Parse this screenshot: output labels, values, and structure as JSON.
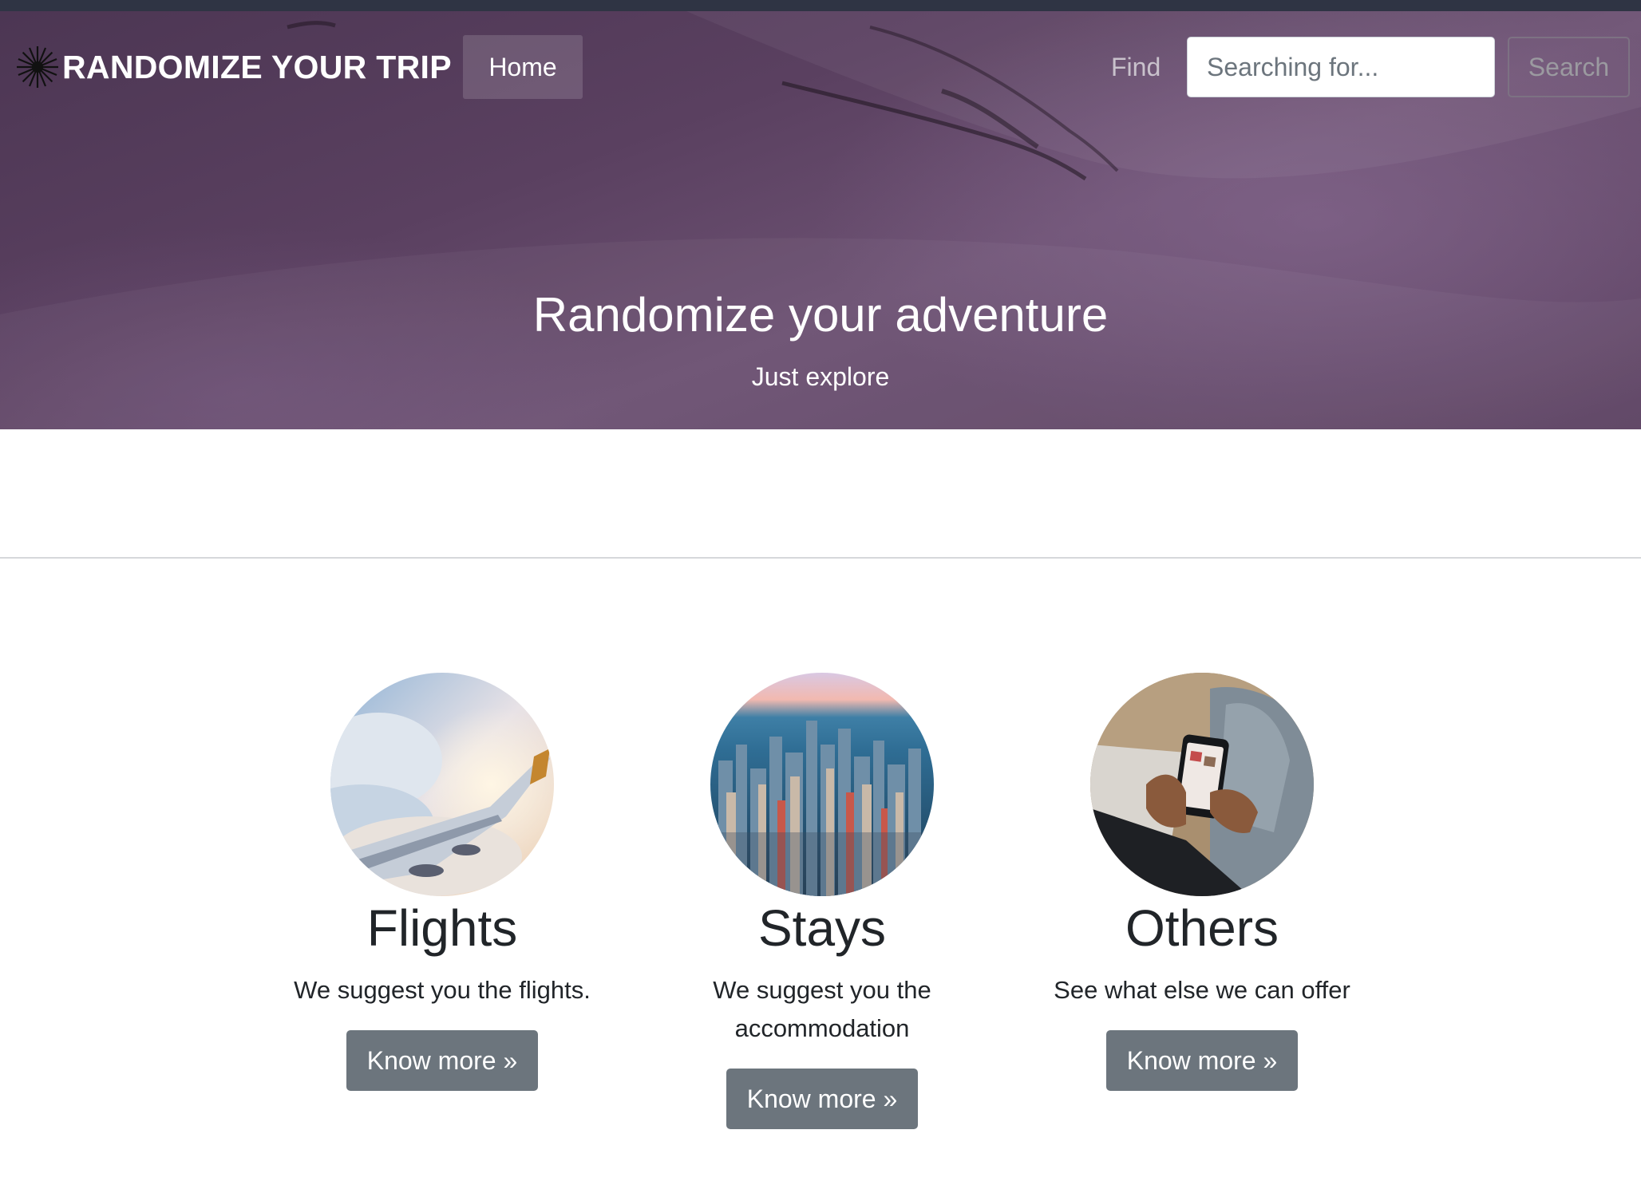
{
  "navbar": {
    "brand": "RANDOMIZE YOUR TRIP",
    "home_label": "Home",
    "find_label": "Find",
    "search_placeholder": "Searching for...",
    "search_button": "Search"
  },
  "hero": {
    "title": "Randomize your adventure",
    "subtitle": "Just explore"
  },
  "features": [
    {
      "title": "Flights",
      "description": "We suggest you the flights.",
      "button": "Know more »",
      "image": "airplane-wing-photo"
    },
    {
      "title": "Stays",
      "description": "We suggest you the accommodation",
      "button": "Know more »",
      "image": "city-skyline-photo"
    },
    {
      "title": "Others",
      "description": "See what else we can offer",
      "button": "Know more »",
      "image": "phone-in-hands-photo"
    }
  ],
  "colors": {
    "hero_overlay": "#5a4060",
    "button_secondary": "#6c757d",
    "topbar": "#2f3444"
  }
}
